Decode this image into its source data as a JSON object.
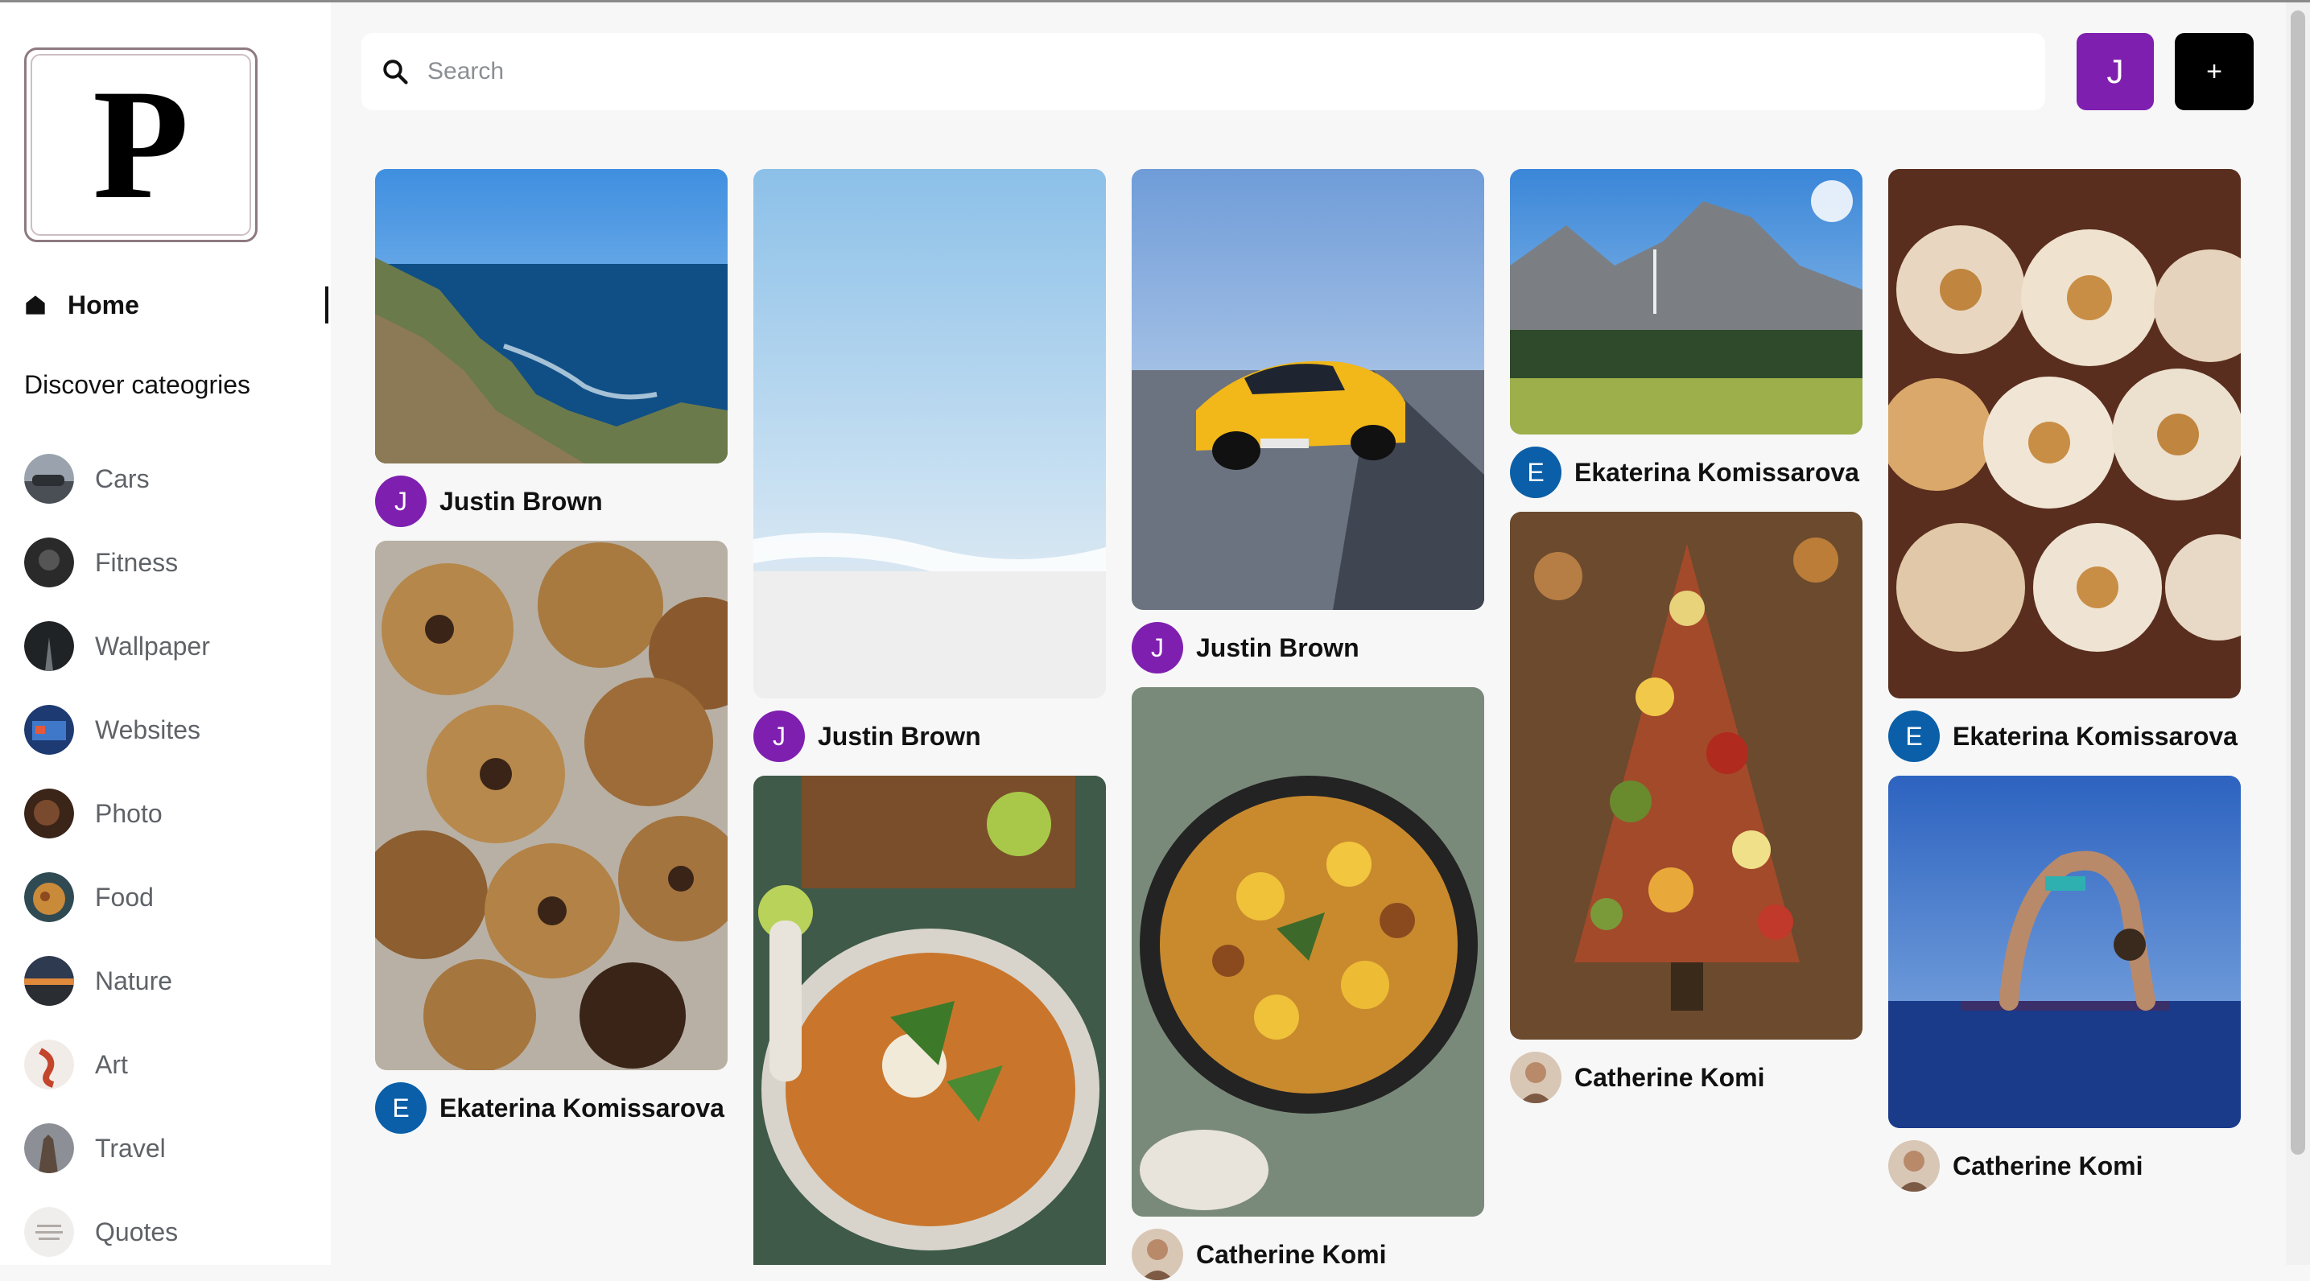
{
  "logo": {
    "letter": "P"
  },
  "nav": {
    "home_label": "Home",
    "discover_label": "Discover cateogries"
  },
  "categories": [
    {
      "label": "Cars",
      "icon": "cars-thumbnail"
    },
    {
      "label": "Fitness",
      "icon": "fitness-thumbnail"
    },
    {
      "label": "Wallpaper",
      "icon": "wallpaper-thumbnail"
    },
    {
      "label": "Websites",
      "icon": "websites-thumbnail"
    },
    {
      "label": "Photo",
      "icon": "photo-thumbnail"
    },
    {
      "label": "Food",
      "icon": "food-thumbnail"
    },
    {
      "label": "Nature",
      "icon": "nature-thumbnail"
    },
    {
      "label": "Art",
      "icon": "art-thumbnail"
    },
    {
      "label": "Travel",
      "icon": "travel-thumbnail"
    },
    {
      "label": "Quotes",
      "icon": "quotes-thumbnail"
    }
  ],
  "header": {
    "search_placeholder": "Search",
    "user_initial": "J",
    "add_label": "+"
  },
  "colors": {
    "avatar_purple": "#7f1fb0",
    "avatar_blue": "#0b5fa8",
    "accent_black": "#000000"
  },
  "pins": [
    {
      "image": "coastline-photo",
      "author": "Justin Brown",
      "initial": "J",
      "avatar_color": "#7f1fb0"
    },
    {
      "image": "cookies-photo",
      "author": "Ekaterina Komissarova",
      "initial": "E",
      "avatar_color": "#0b5fa8"
    },
    {
      "image": "beach-aerial-photo",
      "author": "Justin Brown",
      "initial": "J",
      "avatar_color": "#7f1fb0"
    },
    {
      "image": "curry-bowl-photo",
      "author": "",
      "initial": "",
      "avatar_color": ""
    },
    {
      "image": "yellow-car-photo",
      "author": "Justin Brown",
      "initial": "J",
      "avatar_color": "#7f1fb0"
    },
    {
      "image": "orzo-pan-photo",
      "author": "Catherine Komi",
      "initial": "",
      "avatar_color": ""
    },
    {
      "image": "yosemite-photo",
      "author": "Ekaterina Komissarova",
      "initial": "E",
      "avatar_color": "#0b5fa8"
    },
    {
      "image": "charcuterie-tree-photo",
      "author": "Catherine Komi",
      "initial": "",
      "avatar_color": ""
    },
    {
      "image": "cinnamon-rolls-photo",
      "author": "Ekaterina Komissarova",
      "initial": "E",
      "avatar_color": "#0b5fa8"
    },
    {
      "image": "yoga-water-photo",
      "author": "Catherine Komi",
      "initial": "",
      "avatar_color": ""
    }
  ]
}
